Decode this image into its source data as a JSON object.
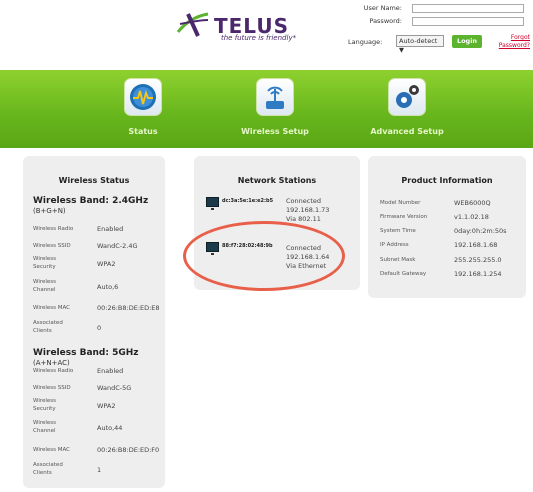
{
  "header": {
    "logo_text": "TELUS",
    "tagline": "the future is friendly*",
    "login": {
      "username_label": "User Name:",
      "password_label": "Password:",
      "language_label": "Language:",
      "language_selected": "Auto-detect ▼",
      "login_button": "Login",
      "forgot_password": "Forgot Password?"
    }
  },
  "nav": {
    "items": [
      {
        "label": "Status",
        "icon": "status-icon"
      },
      {
        "label": "Wireless Setup",
        "icon": "wireless-icon"
      },
      {
        "label": "Advanced Setup",
        "icon": "gears-icon"
      }
    ]
  },
  "wireless_status": {
    "title": "Wireless Status",
    "band_24": {
      "title": "Wireless Band: 2.4GHz",
      "subtitle": "(B+G+N)",
      "rows": [
        {
          "label": "Wireless Radio",
          "value": "Enabled"
        },
        {
          "label": "Wireless SSID",
          "value": "WandC-2.4G"
        },
        {
          "label": "Wireless Security",
          "value": "WPA2"
        },
        {
          "label": "Wireless Channel",
          "value": "Auto,6"
        },
        {
          "label": "Wireless MAC",
          "value": "00:26:B8:DE:ED:E8"
        },
        {
          "label": "Associated Clients",
          "value": "0"
        }
      ]
    },
    "band_5": {
      "title": "Wireless Band: 5GHz",
      "subtitle": "(A+N+AC)",
      "rows": [
        {
          "label": "Wireless Radio",
          "value": "Enabled"
        },
        {
          "label": "Wireless SSID",
          "value": "WandC-5G"
        },
        {
          "label": "Wireless Security",
          "value": "WPA2"
        },
        {
          "label": "Wireless Channel",
          "value": "Auto,44"
        },
        {
          "label": "Wireless MAC",
          "value": "00:26:B8:DE:ED:F0"
        },
        {
          "label": "Associated Clients",
          "value": "1"
        }
      ]
    }
  },
  "network_stations": {
    "title": "Network Stations",
    "stations": [
      {
        "mac": "dc:3a:5e:1e:e2:b5",
        "status": "Connected",
        "ip": "192.168.1.73",
        "via": "Via 802.11"
      },
      {
        "mac": "88:f7:28:02:48:9b",
        "status": "Connected",
        "ip": "192.168.1.64",
        "via": "Via Ethernet"
      }
    ]
  },
  "product_info": {
    "title": "Product Information",
    "rows": [
      {
        "label": "Model Number",
        "value": "WEB6000Q"
      },
      {
        "label": "Firmware Version",
        "value": "v1.1.02.18"
      },
      {
        "label": "System Time",
        "value": "0day:0h:2m:50s"
      },
      {
        "label": "IP Address",
        "value": "192.168.1.68"
      },
      {
        "label": "Subnet Mask",
        "value": "255.255.255.0"
      },
      {
        "label": "Default Gateway",
        "value": "192.168.1.254"
      }
    ]
  },
  "colors": {
    "brand_purple": "#4b286d",
    "nav_green": "#66b51c",
    "login_green": "#5cb32e",
    "highlight": "#e8604a"
  }
}
